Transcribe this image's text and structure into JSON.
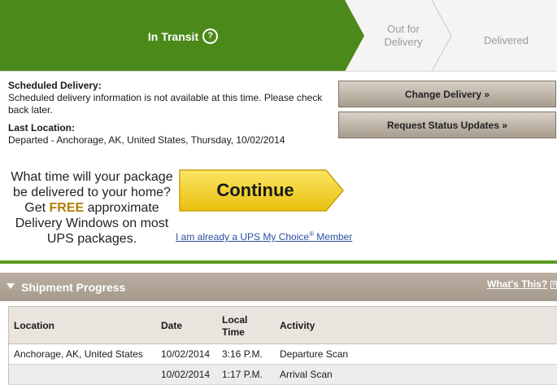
{
  "tracker": {
    "steps": [
      {
        "label": "In Transit",
        "state": "active"
      },
      {
        "label": "Out for Delivery",
        "line1": "Out for",
        "line2": "Delivery",
        "state": "pending"
      },
      {
        "label": "Delivered",
        "state": "pending"
      }
    ],
    "help_icon": "?",
    "colors": {
      "active": "#4b8a1a",
      "pending_bg": "#f4f4f4",
      "pending_text": "#9a9a9a"
    }
  },
  "scheduled": {
    "heading": "Scheduled Delivery:",
    "message": "Scheduled delivery information is not available at this time. Please check back later."
  },
  "last_location": {
    "heading": "Last Location:",
    "value": "Departed - Anchorage, AK, United States, Thursday, 10/02/2014"
  },
  "actions": {
    "change_delivery": "Change Delivery »",
    "request_updates": "Request Status Updates »"
  },
  "promo": {
    "line_a": "What time will your package",
    "line_b": "be delivered to your home?",
    "get": "Get",
    "free": "FREE",
    "approx": "approximate",
    "line_d": "Delivery Windows on most",
    "line_e": "UPS packages.",
    "continue_label": "Continue",
    "member_text": "I am already a UPS My Choice",
    "member_reg": "®",
    "member_suffix": " Member",
    "colors": {
      "button": "#f5d323",
      "free_text": "#b07e00"
    }
  },
  "shipment_progress": {
    "title": "Shipment Progress",
    "whats_this": "What's This?",
    "columns": {
      "location": "Location",
      "date": "Date",
      "local_time_1": "Local",
      "local_time_2": "Time",
      "activity": "Activity"
    },
    "rows": [
      {
        "location": "Anchorage, AK, United States",
        "date": "10/02/2014",
        "time": "3:16 P.M.",
        "activity": "Departure Scan"
      },
      {
        "location": "",
        "date": "10/02/2014",
        "time": "1:17 P.M.",
        "activity": "Arrival Scan"
      }
    ]
  }
}
